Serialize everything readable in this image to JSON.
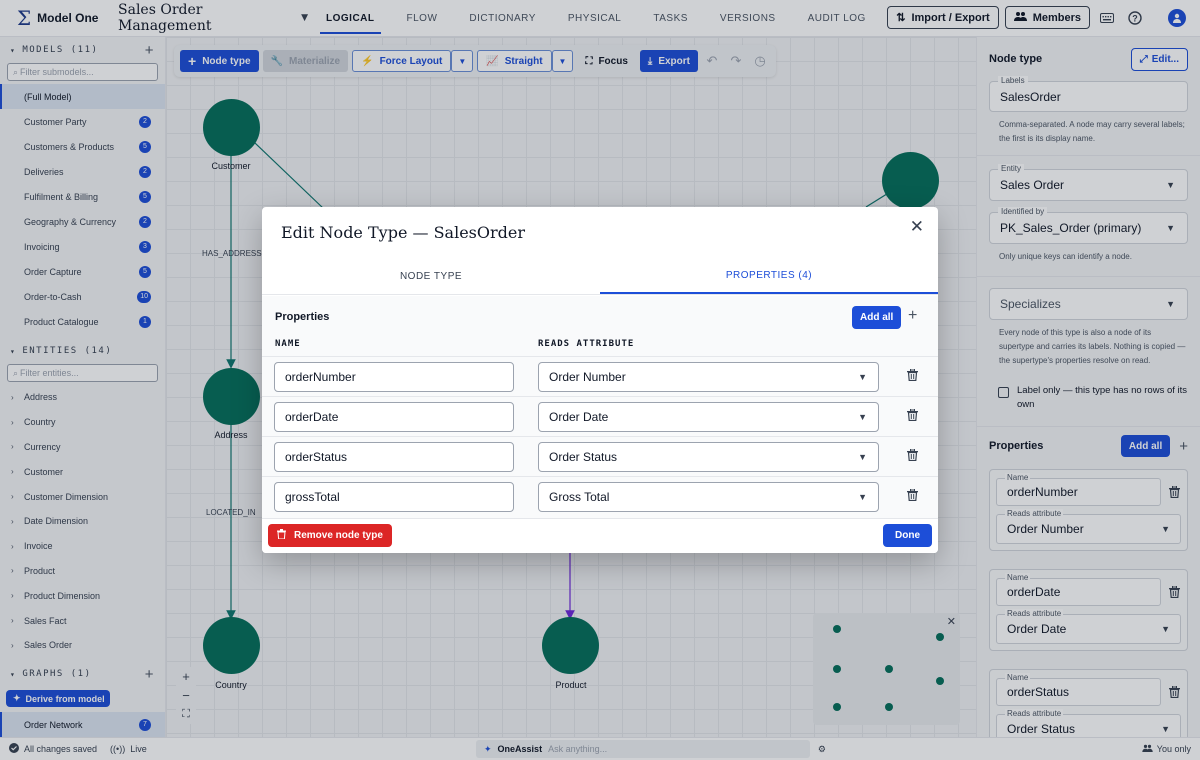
{
  "app": {
    "logo_glyph": "Σ",
    "name": "Model One"
  },
  "project": {
    "title": "Sales Order Management"
  },
  "nav": {
    "tabs": [
      "LOGICAL",
      "FLOW",
      "DICTIONARY",
      "PHYSICAL",
      "TASKS",
      "VERSIONS",
      "AUDIT LOG"
    ],
    "active": 0
  },
  "topbar": {
    "import_export": "Import / Export",
    "members": "Members",
    "avatar_icon": "user-icon"
  },
  "sidebar": {
    "models": {
      "title": "MODELS (11)",
      "filter_placeholder": "Filter submodels...",
      "items": [
        {
          "label": "(Full Model)",
          "count": ""
        },
        {
          "label": "Customer Party",
          "count": "2"
        },
        {
          "label": "Customers & Products",
          "count": "5"
        },
        {
          "label": "Deliveries",
          "count": "2"
        },
        {
          "label": "Fulfilment & Billing",
          "count": "5"
        },
        {
          "label": "Geography & Currency",
          "count": "2"
        },
        {
          "label": "Invoicing",
          "count": "3"
        },
        {
          "label": "Order Capture",
          "count": "5"
        },
        {
          "label": "Order-to-Cash",
          "count": "10"
        },
        {
          "label": "Product Catalogue",
          "count": "1"
        }
      ]
    },
    "entities": {
      "title": "ENTITIES (14)",
      "filter_placeholder": "Filter entities...",
      "items": [
        "Address",
        "Country",
        "Currency",
        "Customer",
        "Customer Dimension",
        "Date Dimension",
        "Invoice",
        "Product",
        "Product Dimension",
        "Sales Fact",
        "Sales Order"
      ]
    },
    "graphs": {
      "title": "GRAPHS (1)",
      "derive_label": "Derive from model",
      "items": [
        {
          "label": "Order Network",
          "count": "7"
        }
      ]
    }
  },
  "canvas_toolbar": {
    "node_type": "Node type",
    "materialize": "Materialize",
    "force_layout": "Force Layout",
    "straight": "Straight",
    "focus": "Focus",
    "export": "Export"
  },
  "graph": {
    "nodes": [
      "Customer",
      "Address",
      "Country",
      "Product"
    ],
    "edges": [
      "HAS_ADDRESS",
      "LOCATED_IN"
    ]
  },
  "zoom": {
    "in": "+",
    "out": "−",
    "fit": "⛶"
  },
  "right_panel": {
    "title": "Node type",
    "edit_label": "Edit...",
    "labels_field": {
      "label": "Labels",
      "value": "SalesOrder",
      "help": "Comma-separated. A node may carry several labels; the first is its display name."
    },
    "entity_field": {
      "label": "Entity",
      "value": "Sales Order"
    },
    "identified_field": {
      "label": "Identified by",
      "value": "PK_Sales_Order (primary)",
      "help": "Only unique keys can identify a node."
    },
    "specializes_field": {
      "placeholder": "Specializes",
      "help": "Every node of this type is also a node of its supertype and carries its labels. Nothing is copied — the supertype's properties resolve on read."
    },
    "label_only": "Label only — this type has no rows of its own",
    "properties_title": "Properties",
    "add_all": "Add all",
    "name_label": "Name",
    "reads_label": "Reads attribute",
    "properties": [
      {
        "name": "orderNumber",
        "attr": "Order Number"
      },
      {
        "name": "orderDate",
        "attr": "Order Date"
      },
      {
        "name": "orderStatus",
        "attr": "Order Status"
      }
    ]
  },
  "statusbar": {
    "saved": "All changes saved",
    "live": "Live",
    "assist_name": "OneAssist",
    "assist_placeholder": "Ask anything...",
    "you_only": "You only"
  },
  "modal": {
    "title": "Edit Node Type — SalesOrder",
    "tabs": [
      "NODE TYPE",
      "PROPERTIES (4)"
    ],
    "active_tab": 1,
    "section": "Properties",
    "add_all": "Add all",
    "col_name": "NAME",
    "col_attr": "READS ATTRIBUTE",
    "rows": [
      {
        "name": "orderNumber",
        "attr": "Order Number"
      },
      {
        "name": "orderDate",
        "attr": "Order Date"
      },
      {
        "name": "orderStatus",
        "attr": "Order Status"
      },
      {
        "name": "grossTotal",
        "attr": "Gross Total"
      }
    ],
    "remove_label": "Remove node type",
    "done_label": "Done"
  },
  "colors": {
    "accent": "#1d4ed8",
    "node": "#066e5b",
    "danger": "#dc2626"
  }
}
